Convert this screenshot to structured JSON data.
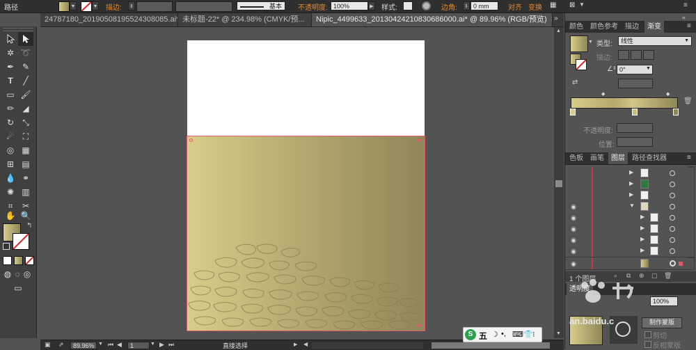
{
  "control_bar": {
    "object_type": "路径",
    "stroke_label": "描边:",
    "stroke_style": "基本",
    "opacity_label": "不透明度:",
    "opacity_value": "100%",
    "style_label": "样式:",
    "corner_label": "边角:",
    "corner_value": "0 mm",
    "align_label": "对齐",
    "transform_label": "变换"
  },
  "tabs": [
    {
      "label": "24787180_20190508195524308085.ai*"
    },
    {
      "label": "未标题-22* @ 234.98% (CMYK/预..."
    },
    {
      "label": "Nipic_4499633_20130424210830686000.ai* @ 89.96% (RGB/预览)",
      "active": true
    }
  ],
  "gradient_panel": {
    "tabs": [
      "颜色",
      "颜色参考",
      "描边",
      "渐变"
    ],
    "type_label": "类型:",
    "type_value": "线性",
    "stroke_label": "描边:",
    "angle_value": "0°",
    "opacity_label": "不透明度:",
    "location_label": "位置:"
  },
  "layers_panel": {
    "tabs": [
      "色板",
      "画笔",
      "图层",
      "路径查找器"
    ],
    "footer_text": "1 个图层"
  },
  "transparency_panel": {
    "tab": "透明度",
    "opacity_value": "100%",
    "mask_button": "制作蒙版",
    "clip_label": "剪切",
    "invert_label": "反相蒙版"
  },
  "status_bar": {
    "zoom": "89.96%",
    "page": "1",
    "tool_name": "直接选择"
  },
  "ime": {
    "label": "五"
  },
  "watermark": {
    "text": "an.baidu.c"
  },
  "colors": {
    "accent_orange": "#e58a2b",
    "selection_red": "#e05a6a",
    "gradient_start": "#d8cd8a",
    "gradient_end": "#8e8758"
  }
}
